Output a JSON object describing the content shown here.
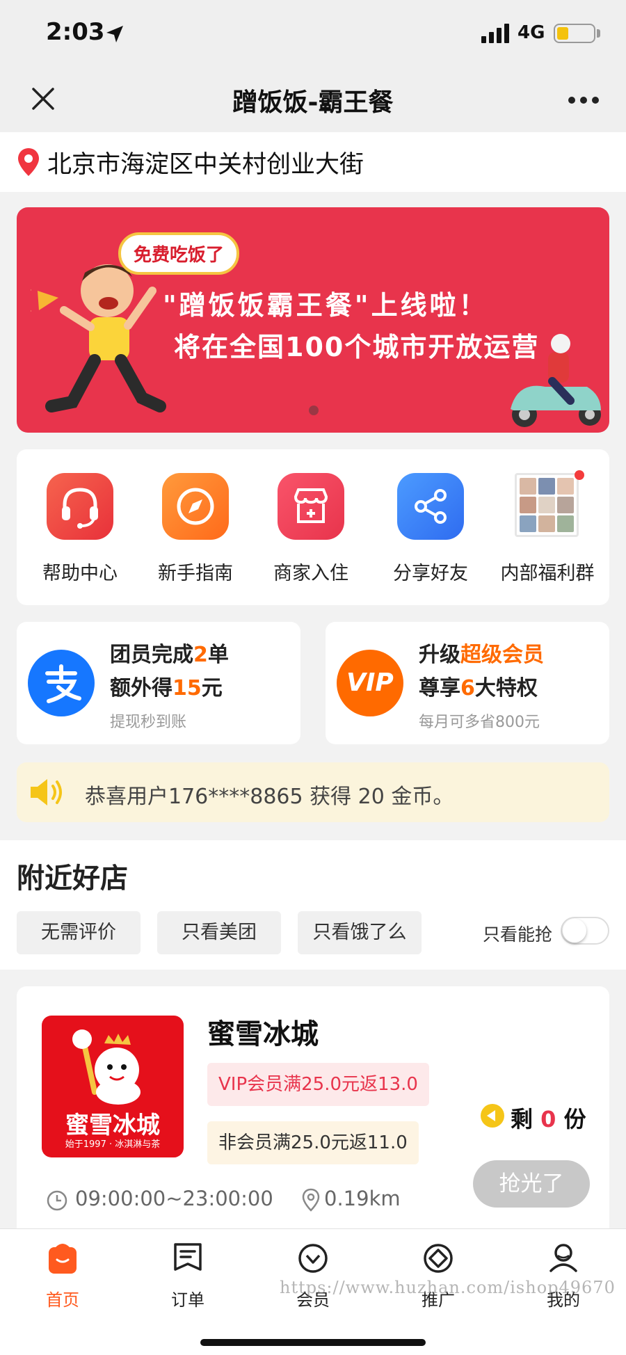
{
  "status_bar": {
    "time": "2:03",
    "network": "4G"
  },
  "nav": {
    "title": "蹭饭饭-霸王餐"
  },
  "location": {
    "address": "北京市海淀区中关村创业大街"
  },
  "banner": {
    "tag": "免费吃饭了",
    "line1": "\"蹭饭饭霸王餐\"上线啦！",
    "line2": "将在全国100个城市开放运营"
  },
  "quick_menu": [
    {
      "label": "帮助中心",
      "icon": "headset-icon",
      "color": "#f0453a"
    },
    {
      "label": "新手指南",
      "icon": "compass-icon",
      "color": "#ff7a1a"
    },
    {
      "label": "商家入住",
      "icon": "shop-icon",
      "color": "#f23e4a"
    },
    {
      "label": "分享好友",
      "icon": "share-icon",
      "color": "#2f80f5"
    },
    {
      "label": "内部福利群",
      "icon": "group-photo-icon"
    }
  ],
  "promos": [
    {
      "line1_a": "团员完成",
      "line1_num": "2",
      "line1_b": "单",
      "line2_a": "额外得",
      "line2_num": "15",
      "line2_b": "元",
      "sub": "提现秒到账",
      "icon": "alipay-icon",
      "color": "#1677ff"
    },
    {
      "line1_a": "升级",
      "line1_hl": "超级会员",
      "line2_a": "尊享",
      "line2_num": "6",
      "line2_b": "大特权",
      "sub": "每月可多省800元",
      "icon": "vip-icon",
      "badge": "VIP",
      "color": "#ff6a00"
    }
  ],
  "notice": {
    "text": "恭喜用户176****8865 获得 20 金币。"
  },
  "nearby": {
    "title": "附近好店",
    "filters": [
      "无需评价",
      "只看美团",
      "只看饿了么"
    ],
    "toggle_label": "只看能抢",
    "toggle_on": false
  },
  "shop": {
    "name": "蜜雪冰城",
    "logo_text": "蜜雪冰城",
    "logo_sub": "始于1997 · 冰淇淋与茶",
    "vip_offer": "VIP会员满25.0元返13.0",
    "non_member_offer": "非会员满25.0元返11.0",
    "remain_prefix": "剩",
    "remain_count": "0",
    "remain_suffix": "份",
    "button": "抢光了",
    "hours": "09:00:00~23:00:00",
    "distance": "0.19km"
  },
  "tabbar": [
    {
      "label": "首页",
      "icon": "home-icon",
      "active": true
    },
    {
      "label": "订单",
      "icon": "order-icon",
      "active": false
    },
    {
      "label": "会员",
      "icon": "member-icon",
      "active": false
    },
    {
      "label": "推广",
      "icon": "promote-icon",
      "active": false
    },
    {
      "label": "我的",
      "icon": "profile-icon",
      "active": false
    }
  ],
  "watermark": "https://www.huzhan.com/ishop49670",
  "colors": {
    "brand_red": "#e8344c",
    "accent_orange": "#ff6a00",
    "notice_bg": "#fbf4dc"
  }
}
